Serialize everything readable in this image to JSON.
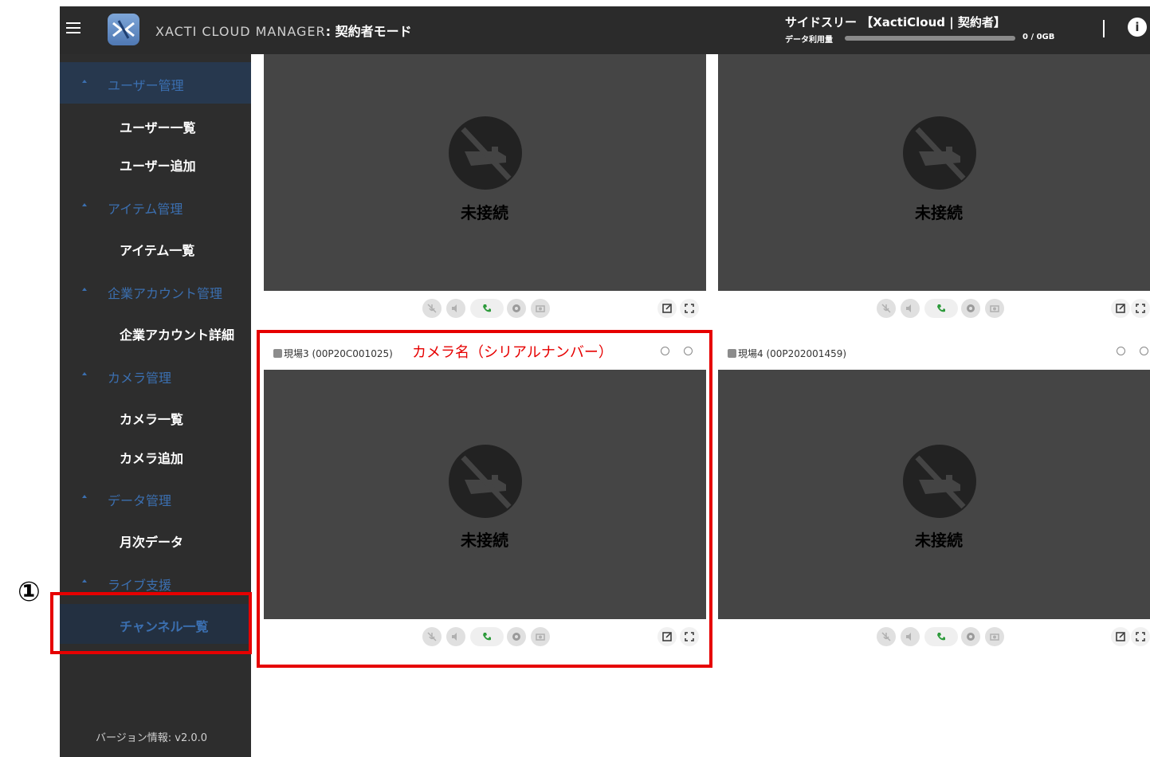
{
  "header": {
    "app_title": "XACTI CLOUD MANAGER",
    "mode": ": 契約者モード",
    "account": "サイドスリー 【XactiCloud | 契約者】",
    "usage_label": "データ利用量",
    "usage_text": "0 / 0GB",
    "usage_percent": 0,
    "info_icon": "i"
  },
  "sidebar": {
    "sections": [
      {
        "label": "ユーザー管理",
        "items": [
          "ユーザー一覧",
          "ユーザー追加"
        ]
      },
      {
        "label": "アイテム管理",
        "items": [
          "アイテム一覧"
        ]
      },
      {
        "label": "企業アカウント管理",
        "items": [
          "企業アカウント詳細"
        ]
      },
      {
        "label": "カメラ管理",
        "items": [
          "カメラ一覧",
          "カメラ追加"
        ]
      },
      {
        "label": "データ管理",
        "items": [
          "月次データ"
        ]
      },
      {
        "label": "ライブ支援",
        "items": [
          "チャンネル一覧"
        ]
      }
    ],
    "version": "バージョン情報: v2.0.0"
  },
  "cards": [
    {
      "title": "",
      "status": "未接続"
    },
    {
      "title": "",
      "status": "未接続"
    },
    {
      "title": "現場3 (00P20C001025)",
      "status": "未接続"
    },
    {
      "title": "現場4 (00P202001459)",
      "status": "未接続"
    }
  ],
  "annotations": {
    "step_number": "①",
    "caption": "カメラ名（シリアルナンバー）"
  },
  "icons": {
    "menu": "hamburger-icon",
    "logo": "xacti-logo",
    "camera_off": "camera-off-icon",
    "mic": "mic-off-icon",
    "speaker": "speaker-off-icon",
    "call": "phone-icon",
    "record": "record-icon",
    "snapshot": "snapshot-icon",
    "popout": "open-in-new-icon",
    "fullscreen": "fullscreen-icon"
  },
  "colors": {
    "header_bg": "#2b2b2b",
    "sidebar_bg": "#2d2d2d",
    "sidebar_accent": "#3b6fb0",
    "video_bg": "#454545",
    "annotation": "#e60000",
    "call_green": "#2e9b3c"
  }
}
